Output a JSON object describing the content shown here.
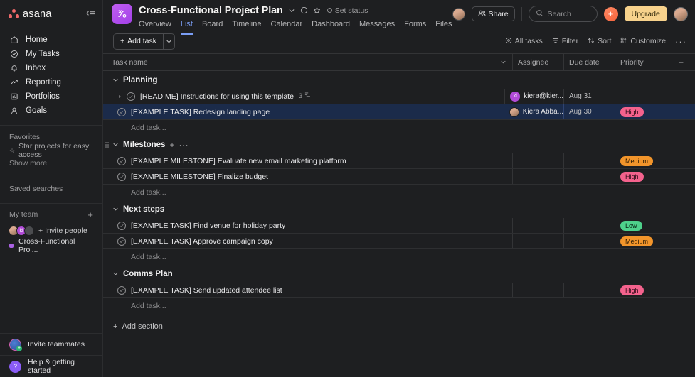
{
  "sidebar": {
    "logo_text": "asana",
    "collapse_icon": "collapse-sidebar-icon",
    "nav": [
      {
        "label": "Home",
        "icon": "home-icon"
      },
      {
        "label": "My Tasks",
        "icon": "check-circle-icon"
      },
      {
        "label": "Inbox",
        "icon": "bell-icon"
      },
      {
        "label": "Reporting",
        "icon": "chart-line-icon"
      },
      {
        "label": "Portfolios",
        "icon": "portfolio-icon"
      },
      {
        "label": "Goals",
        "icon": "goal-icon"
      }
    ],
    "favorites": {
      "title": "Favorites",
      "hint": "Star projects for easy access",
      "show_more": "Show more"
    },
    "saved_searches": {
      "title": "Saved searches"
    },
    "my_team": {
      "title": "My team",
      "add_label": "+",
      "invite_label": "Invite people",
      "avatars": [
        "",
        "ki",
        ""
      ],
      "project": "Cross-Functional Proj..."
    },
    "bottom": [
      {
        "label": "Invite teammates",
        "icon": "invite-teammates-icon"
      },
      {
        "label": "Help & getting started",
        "icon": "help-icon"
      }
    ]
  },
  "header": {
    "project_icon": "project-glyph-icon",
    "title": "Cross-Functional Project Plan",
    "chevron_icon": "chevron-down-icon",
    "info_icon": "info-circle-icon",
    "star_icon": "star-icon",
    "set_status": "Set status",
    "tabs": [
      {
        "label": "Overview",
        "active": false
      },
      {
        "label": "List",
        "active": true
      },
      {
        "label": "Board",
        "active": false
      },
      {
        "label": "Timeline",
        "active": false
      },
      {
        "label": "Calendar",
        "active": false
      },
      {
        "label": "Dashboard",
        "active": false
      },
      {
        "label": "Messages",
        "active": false
      },
      {
        "label": "Forms",
        "active": false
      },
      {
        "label": "Files",
        "active": false
      }
    ],
    "share_label": "Share",
    "search_placeholder": "Search",
    "create_label": "+",
    "upgrade_label": "Upgrade"
  },
  "toolbar": {
    "add_task_label": "Add task",
    "add_task_caret_icon": "chevron-down-icon",
    "all_tasks_label": "All tasks",
    "filter_label": "Filter",
    "sort_label": "Sort",
    "customize_label": "Customize",
    "more_label": "···"
  },
  "table": {
    "columns": {
      "task_name": "Task name",
      "assignee": "Assignee",
      "due_date": "Due date",
      "priority": "Priority",
      "add_column": "+"
    },
    "add_task_placeholder": "Add task...",
    "add_section_label": "Add section"
  },
  "sections": [
    {
      "name": "Planning",
      "show_actions": false,
      "show_drag": false,
      "tasks": [
        {
          "name": "[READ ME] Instructions for using this template",
          "has_expand_arrow": true,
          "subtask_count": "3",
          "assignee": "kiera@kier...",
          "assignee_initials": "ki",
          "assignee_type": "initials",
          "due_date": "Aug 31",
          "priority": "",
          "priority_level": "",
          "selected": false
        },
        {
          "name": "[EXAMPLE TASK] Redesign landing page",
          "has_expand_arrow": false,
          "subtask_count": "",
          "assignee": "Kiera Abba...",
          "assignee_initials": "",
          "assignee_type": "photo",
          "due_date": "Aug 30",
          "priority": "High",
          "priority_level": "high",
          "selected": true
        }
      ]
    },
    {
      "name": "Milestones",
      "show_actions": true,
      "show_drag": true,
      "tasks": [
        {
          "name": "[EXAMPLE MILESTONE] Evaluate new email marketing platform",
          "has_expand_arrow": false,
          "subtask_count": "",
          "assignee": "",
          "assignee_initials": "",
          "assignee_type": "",
          "due_date": "",
          "priority": "Medium",
          "priority_level": "medium",
          "selected": false
        },
        {
          "name": "[EXAMPLE MILESTONE] Finalize budget",
          "has_expand_arrow": false,
          "subtask_count": "",
          "assignee": "",
          "assignee_initials": "",
          "assignee_type": "",
          "due_date": "",
          "priority": "High",
          "priority_level": "high",
          "selected": false
        }
      ]
    },
    {
      "name": "Next steps",
      "show_actions": false,
      "show_drag": false,
      "tasks": [
        {
          "name": "[EXAMPLE TASK] Find venue for holiday party",
          "has_expand_arrow": false,
          "subtask_count": "",
          "assignee": "",
          "assignee_initials": "",
          "assignee_type": "",
          "due_date": "",
          "priority": "Low",
          "priority_level": "low",
          "selected": false
        },
        {
          "name": "[EXAMPLE TASK] Approve campaign copy",
          "has_expand_arrow": false,
          "subtask_count": "",
          "assignee": "",
          "assignee_initials": "",
          "assignee_type": "",
          "due_date": "",
          "priority": "Medium",
          "priority_level": "medium",
          "selected": false
        }
      ]
    },
    {
      "name": "Comms Plan",
      "show_actions": false,
      "show_drag": false,
      "tasks": [
        {
          "name": "[EXAMPLE TASK] Send updated attendee list",
          "has_expand_arrow": false,
          "subtask_count": "",
          "assignee": "",
          "assignee_initials": "",
          "assignee_type": "",
          "due_date": "",
          "priority": "High",
          "priority_level": "high",
          "selected": false
        }
      ]
    }
  ],
  "colors": {
    "background": "#1e1f21",
    "accent_blue": "#7a9df5",
    "brand_red": "#f06a6a",
    "project_purple": "#b24bd8",
    "upgrade_yellow": "#f7d28c",
    "priority_high": "#f4628d",
    "priority_medium": "#f2952b",
    "priority_low": "#4ed18b",
    "selected_row": "#1b2b4a"
  }
}
